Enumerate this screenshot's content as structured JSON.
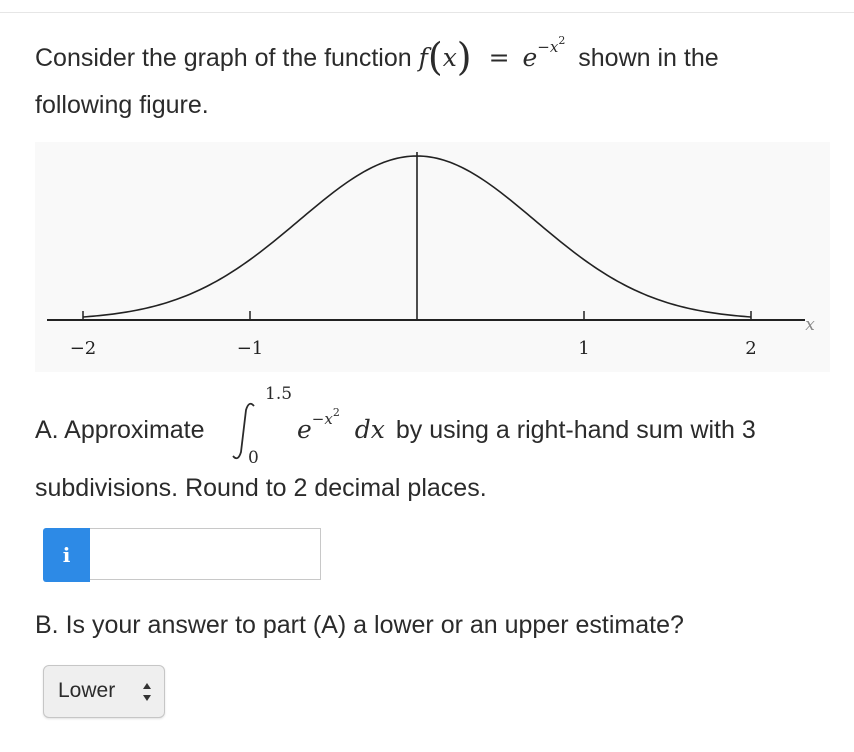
{
  "question": {
    "intro_before": "Consider the graph of the function",
    "func_name": "f",
    "func_arg": "x",
    "equals": "=",
    "exp_base": "e",
    "exp_power": "−x",
    "exp_square": "2",
    "intro_after": "shown in the",
    "intro_line2": "following figure."
  },
  "part_a": {
    "lead": "A. Approximate",
    "integral_upper": "1.5",
    "integral_lower": "0",
    "integrand_base": "e",
    "integrand_power": "−x",
    "integrand_square": "2",
    "differential": "dx",
    "tail": "by using a right-hand sum with 3",
    "line2": "subdivisions. Round to 2 decimal places."
  },
  "answer": {
    "info_icon": "i",
    "info_icon_name": "info-icon",
    "value": "",
    "accent_color": "#2d8ae6"
  },
  "part_b": {
    "question": "B. Is your answer to part (A) a lower or an upper estimate?",
    "selected": "Lower"
  },
  "chart_data": {
    "type": "line",
    "function": "exp(-x^2)",
    "xlim": [
      -2.0,
      2.0
    ],
    "ylim": [
      0,
      1
    ],
    "x_ticks": [
      -2,
      -1,
      1,
      2
    ],
    "x_tick_labels": [
      "−2",
      "−1",
      "1",
      "2"
    ],
    "xlabel": "x",
    "ylabel": "",
    "vertical_line_x": 0,
    "grid": false
  }
}
